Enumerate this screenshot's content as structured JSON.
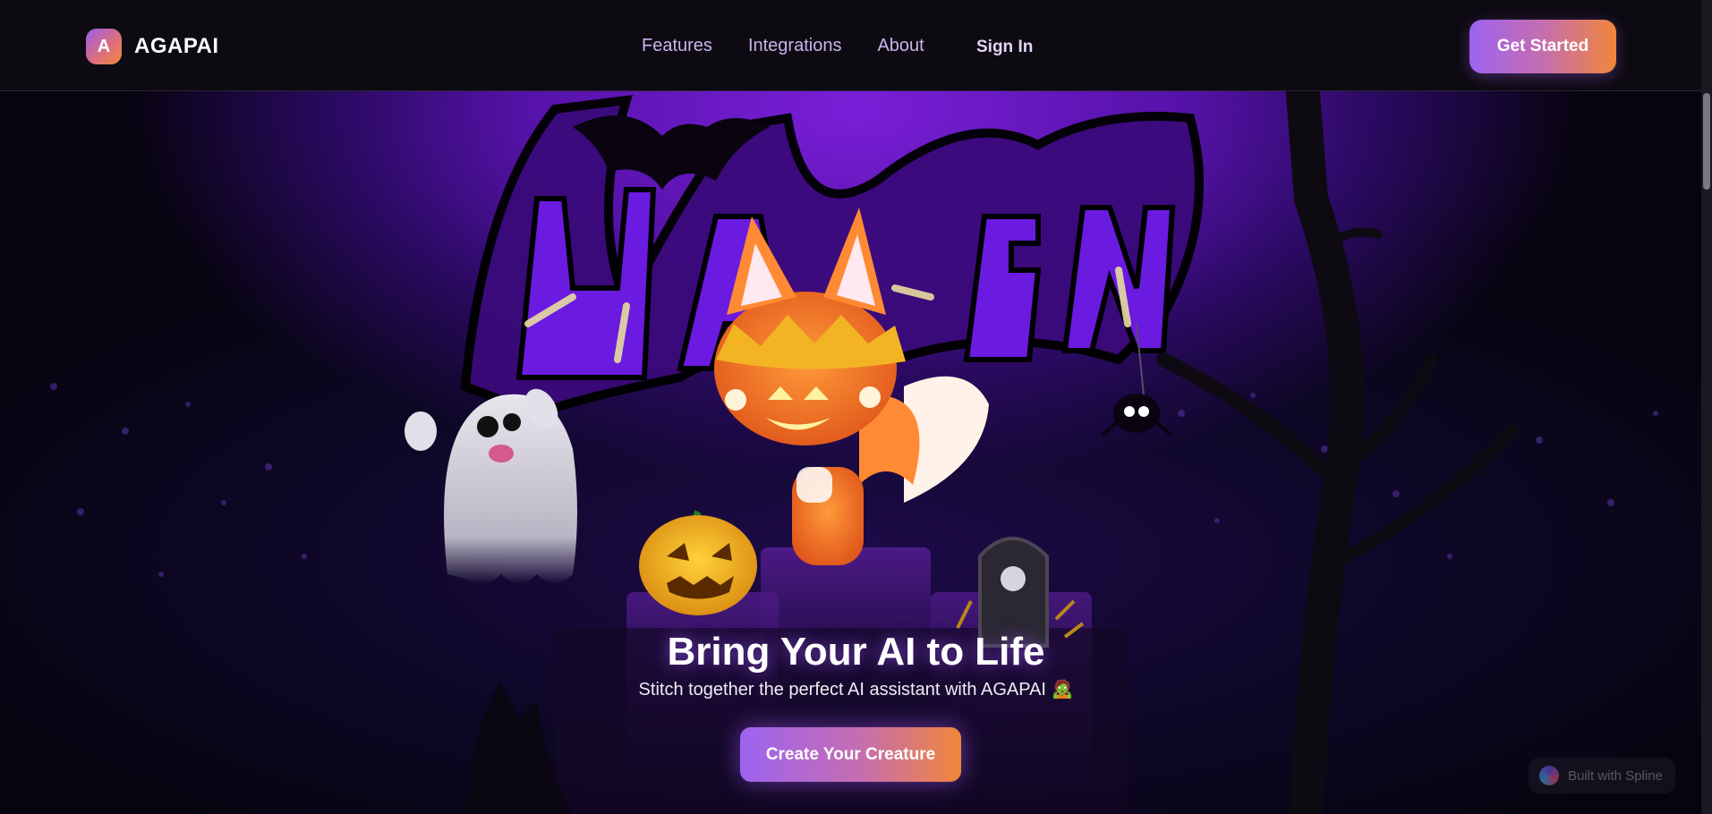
{
  "brand": {
    "logo_letter": "A",
    "name": "AGAPAI"
  },
  "nav": {
    "links": [
      {
        "label": "Features"
      },
      {
        "label": "Integrations"
      },
      {
        "label": "About"
      }
    ],
    "sign_in": "Sign In",
    "cta": "Get Started"
  },
  "hero": {
    "title": "Bring Your AI to Life",
    "subtitle": "Stitch together the perfect AI assistant with AGAPAI 🧟",
    "cta": "Create Your Creature",
    "scene_title": "Halloween"
  },
  "spline_badge": "Built with Spline",
  "colors": {
    "accent_purple": "#9d63f0",
    "accent_orange": "#f1863a",
    "nav_link": "#c6b6ec",
    "page_bg": "#07050b"
  },
  "icons": [
    "bat-icon",
    "ghost-icon",
    "fox-icon",
    "pumpkin-icon",
    "tombstone-icon",
    "spider-icon",
    "tree-icon"
  ]
}
